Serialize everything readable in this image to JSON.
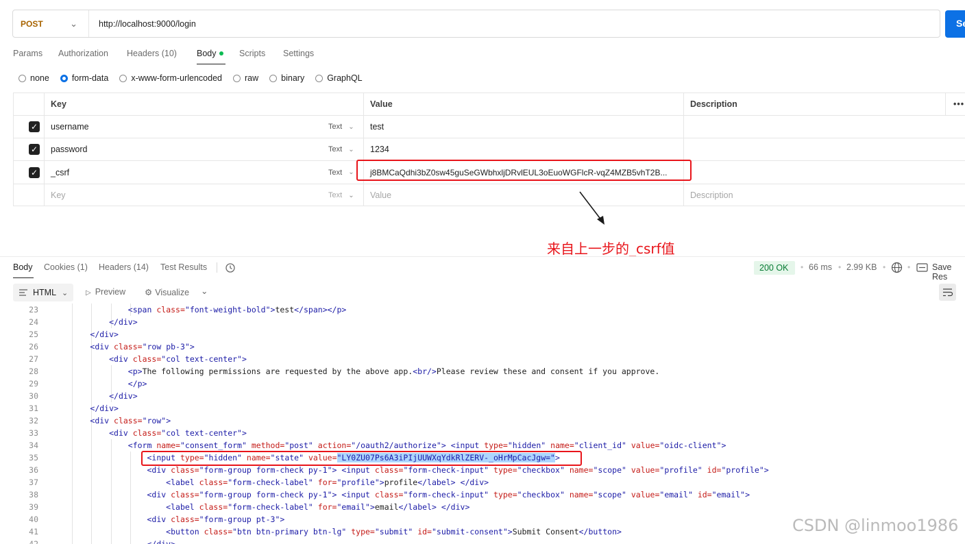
{
  "request": {
    "method": "POST",
    "url": "http://localhost:9000/login",
    "send_label": "Se"
  },
  "request_tabs": [
    {
      "label": "Params"
    },
    {
      "label": "Authorization"
    },
    {
      "label": "Headers (10)"
    },
    {
      "label": "Body"
    },
    {
      "label": "Scripts"
    },
    {
      "label": "Settings"
    }
  ],
  "body_types": [
    "none",
    "form-data",
    "x-www-form-urlencoded",
    "raw",
    "binary",
    "GraphQL"
  ],
  "form_table": {
    "headers": {
      "key": "Key",
      "value": "Value",
      "description": "Description",
      "more": "•••"
    },
    "rows": [
      {
        "key": "username",
        "type": "Text",
        "value": "test"
      },
      {
        "key": "password",
        "type": "Text",
        "value": "1234"
      },
      {
        "key": "_csrf",
        "type": "Text",
        "value": "j8BMCaQdhi3bZ0sw45guSeGWbhxljDRvlEUL3oEuoWGFlcR-vqZ4MZB5vhT2B..."
      }
    ],
    "empty_row": {
      "key": "Key",
      "type": "Text",
      "value": "Value",
      "description": "Description"
    }
  },
  "annotation": {
    "text": "来自上一步的_csrf值"
  },
  "response_tabs": [
    {
      "label": "Body"
    },
    {
      "label": "Cookies (1)"
    },
    {
      "label": "Headers (14)"
    },
    {
      "label": "Test Results"
    }
  ],
  "response_meta": {
    "status": "200 OK",
    "time": "66 ms",
    "size": "2.99 KB",
    "save_label": "Save Res"
  },
  "response_toolbar": {
    "format": "HTML",
    "preview": "Preview",
    "visualize": "Visualize"
  },
  "code_lines": [
    23,
    24,
    25,
    26,
    27,
    28,
    29,
    30,
    31,
    32,
    33,
    34,
    35,
    36,
    37,
    38,
    39,
    40,
    41,
    42
  ],
  "watermark": "CSDN @linmoo1986",
  "colors": {
    "accent": "#0c71e5",
    "annotation": "#e8141a",
    "status_ok": "#067a32"
  }
}
